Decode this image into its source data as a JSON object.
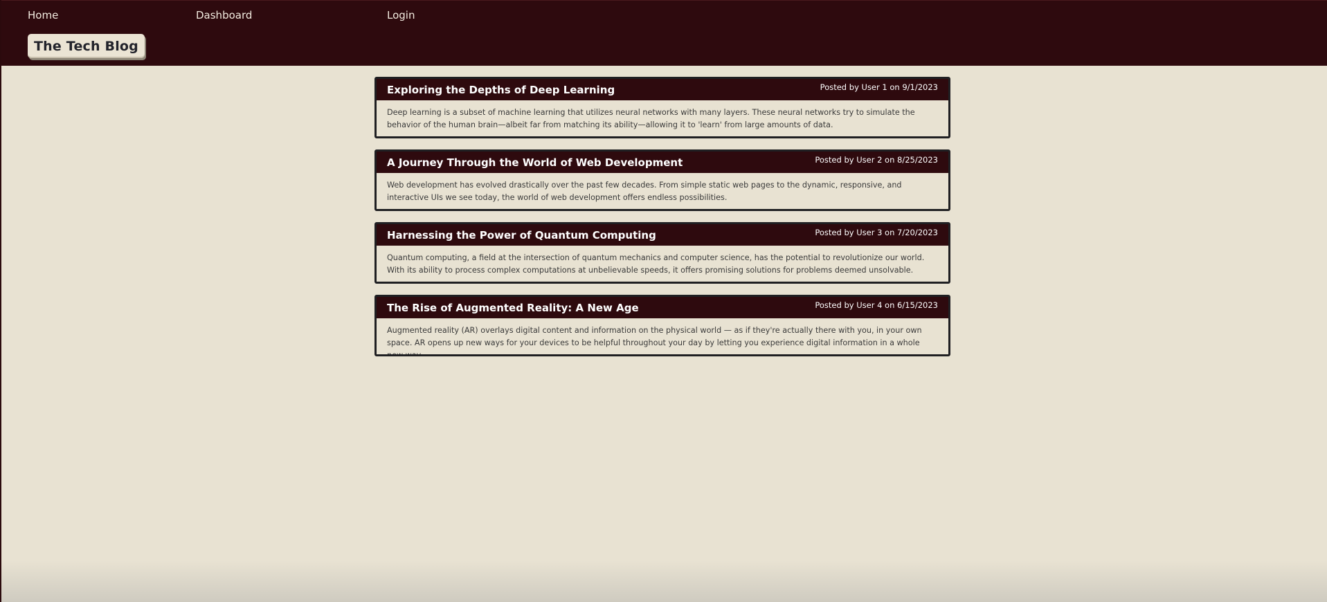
{
  "nav": {
    "home": "Home",
    "dashboard": "Dashboard",
    "login": "Login"
  },
  "brand": {
    "title": "The Tech Blog"
  },
  "posts": [
    {
      "title": "Exploring the Depths of Deep Learning",
      "meta": "Posted by User 1 on 9/1/2023",
      "body": "Deep learning is a subset of machine learning that utilizes neural networks with many layers. These neural networks try to simulate the behavior of the human brain—albeit far from matching its ability—allowing it to 'learn' from large amounts of data."
    },
    {
      "title": "A Journey Through the World of Web Development",
      "meta": "Posted by User 2 on 8/25/2023",
      "body": "Web development has evolved drastically over the past few decades. From simple static web pages to the dynamic, responsive, and interactive UIs we see today, the world of web development offers endless possibilities."
    },
    {
      "title": "Harnessing the Power of Quantum Computing",
      "meta": "Posted by User 3 on 7/20/2023",
      "body": "Quantum computing, a field at the intersection of quantum mechanics and computer science, has the potential to revolutionize our world. With its ability to process complex computations at unbelievable speeds, it offers promising solutions for problems deemed unsolvable."
    },
    {
      "title": "The Rise of Augmented Reality: A New Age",
      "meta": "Posted by User 4 on 6/15/2023",
      "body": "Augmented reality (AR) overlays digital content and information on the physical world — as if they're actually there with you, in your own space. AR opens up new ways for your devices to be helpful throughout your day by letting you experience digital information in a whole new way."
    }
  ],
  "colors": {
    "header_bg": "#2e0a0e",
    "page_bg": "#e8e2d2",
    "card_border": "#1f1f22"
  }
}
